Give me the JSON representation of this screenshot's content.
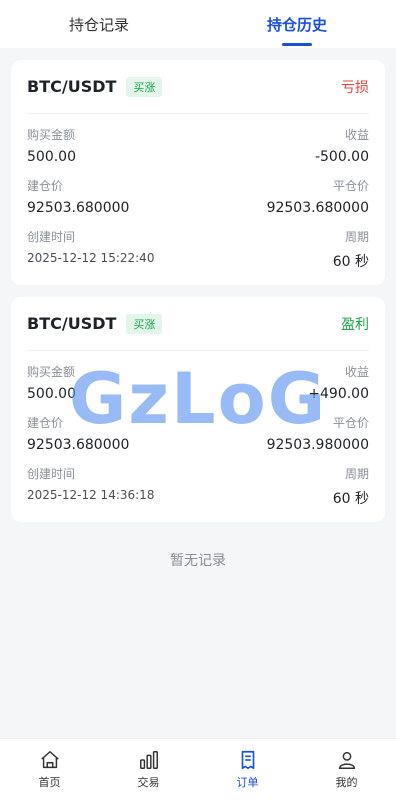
{
  "tabs": [
    {
      "label": "持仓记录"
    },
    {
      "label": "持仓历史"
    }
  ],
  "orders": [
    {
      "pair": "BTC/USDT",
      "direction": "买涨",
      "result": "亏损",
      "amount_label": "购买金额",
      "amount": "500.00",
      "profit_label": "收益",
      "profit": "-500.00",
      "open_label": "建仓价",
      "open_price": "92503.680000",
      "close_label": "平仓价",
      "close_price": "92503.680000",
      "time_label": "创建时间",
      "time": "2025-12-12 15:22:40",
      "period_label": "周期",
      "period": "60 秒"
    },
    {
      "pair": "BTC/USDT",
      "direction": "买涨",
      "result": "盈利",
      "amount_label": "购买金额",
      "amount": "500.00",
      "profit_label": "收益",
      "profit": "+490.00",
      "open_label": "建仓价",
      "open_price": "92503.680000",
      "close_label": "平仓价",
      "close_price": "92503.980000",
      "time_label": "创建时间",
      "time": "2025-12-12 14:36:18",
      "period_label": "周期",
      "period": "60 秒"
    }
  ],
  "empty_text": "暂无记录",
  "watermark": "GzLoG",
  "nav": [
    {
      "label": "首页",
      "icon": "home-icon"
    },
    {
      "label": "交易",
      "icon": "chart-bars-icon"
    },
    {
      "label": "订单",
      "icon": "order-doc-icon"
    },
    {
      "label": "我的",
      "icon": "user-icon"
    }
  ],
  "colors": {
    "accent": "#1a4fd6",
    "loss": "#e5453c",
    "gain": "#1aa64a"
  }
}
